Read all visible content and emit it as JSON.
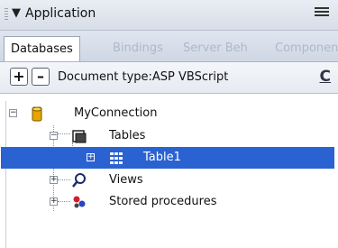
{
  "panel": {
    "title": "Application",
    "tabs": [
      {
        "label": "Databases"
      },
      {
        "label": "Bindings"
      },
      {
        "label": "Server Beh"
      },
      {
        "label": "Component"
      }
    ]
  },
  "toolbar": {
    "add_label": "+",
    "remove_label": "–",
    "doc_type": "Document type:ASP VBScript",
    "refresh_label": "C"
  },
  "tree": [
    {
      "label": "MyConnection",
      "level": 0,
      "expanded": true,
      "icon": "database-icon"
    },
    {
      "label": "Tables",
      "level": 1,
      "expanded": true,
      "icon": "tables-icon"
    },
    {
      "label": "Table1",
      "level": 2,
      "expanded": false,
      "selected": true,
      "icon": "table-icon"
    },
    {
      "label": "Views",
      "level": 1,
      "expanded": false,
      "icon": "views-icon"
    },
    {
      "label": "Stored procedures",
      "level": 1,
      "expanded": false,
      "icon": "stored-procedures-icon"
    }
  ],
  "colors": {
    "selection": "#2a62d1",
    "titlebar": "#d8dde8"
  }
}
